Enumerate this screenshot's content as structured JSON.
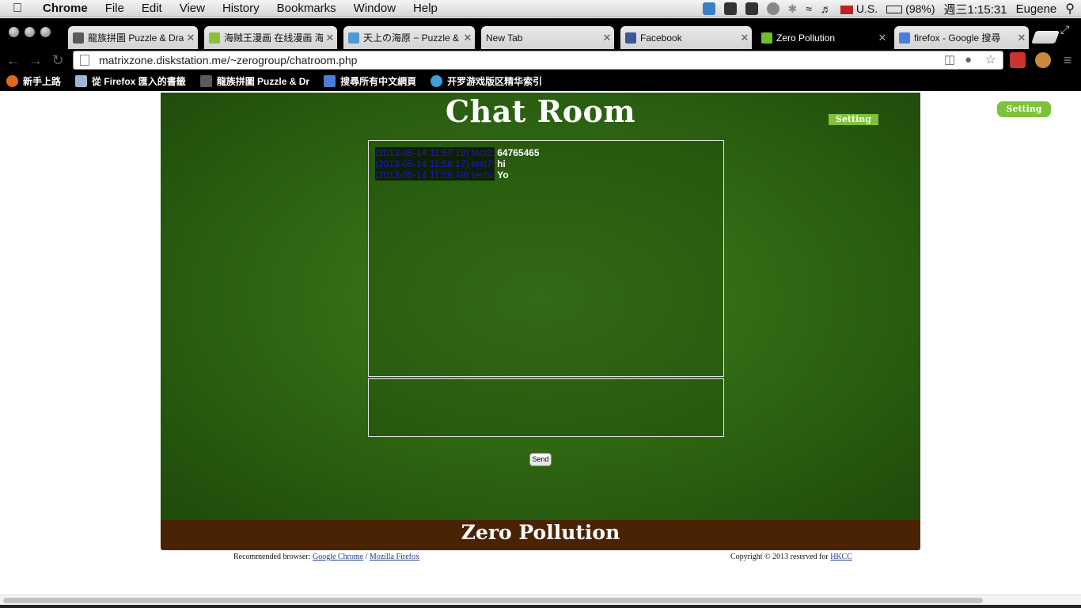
{
  "os_menu": {
    "app_name": "Chrome",
    "items": [
      "File",
      "Edit",
      "View",
      "History",
      "Bookmarks",
      "Window",
      "Help"
    ],
    "input_source": "U.S.",
    "battery": "(98%)",
    "clock": "週三1:15:31",
    "user": "Eugene"
  },
  "tabs": [
    {
      "label": "龍族拼圖 Puzzle & Drag",
      "favicon_color": "#5a5a5a"
    },
    {
      "label": "海贼王漫画 在线漫画 海贼",
      "favicon_color": "#8fbf3a"
    },
    {
      "label": "天上の海原 − Puzzle & D",
      "favicon_color": "#4a9ad4"
    },
    {
      "label": "New Tab",
      "favicon_color": ""
    },
    {
      "label": "Facebook",
      "favicon_color": "#3b5998"
    },
    {
      "label": "Zero Pollution",
      "favicon_color": "#6fbf2a"
    },
    {
      "label": "firefox - Google 搜尋",
      "favicon_color": "#4a7ed8"
    }
  ],
  "address_bar": {
    "url": "matrixzone.diskstation.me/~zerogroup/chatroom.php"
  },
  "bookmarks": [
    {
      "label": "新手上路",
      "icon_color": "#e06a1a"
    },
    {
      "label": "從 Firefox 匯入的書籤",
      "icon_color": "#9fb5d6"
    },
    {
      "label": "龍族拼圖 Puzzle & Dr",
      "icon_color": "#5a5a5a"
    },
    {
      "label": "搜尋所有中文網頁",
      "icon_color": "#4a7ed8"
    },
    {
      "label": "开罗游戏版区精华索引",
      "icon_color": "#3aa0e0"
    }
  ],
  "chatroom": {
    "title": "Chat Room",
    "setting_inner_label": "Setting",
    "setting_outer_label": "Setting",
    "messages": [
      {
        "meta": "(2013-05-14 11:57:19) test2:",
        "text": "64765465"
      },
      {
        "meta": "(2013-05-14 11:58:17) test7:",
        "text": "hi"
      },
      {
        "meta": "(2013-05-14 11:59:49) test5:",
        "text": "Yo"
      }
    ],
    "input_value": "",
    "send_label": "Send",
    "footer_title": "Zero Pollution"
  },
  "footer": {
    "recommended_prefix": "Recommended browser: ",
    "chrome_link": "Google Chrome",
    "separator": " / ",
    "firefox_link": "Mozilla Firefox",
    "copyright_prefix": "Copyright © 2013 reserved for ",
    "copyright_link": "HKCC"
  },
  "colors": {
    "panel_green": "#2f6813",
    "footer_brown": "#4a2206",
    "setting_green": "#7dc23a",
    "chat_meta_blue": "#1a1acc"
  }
}
